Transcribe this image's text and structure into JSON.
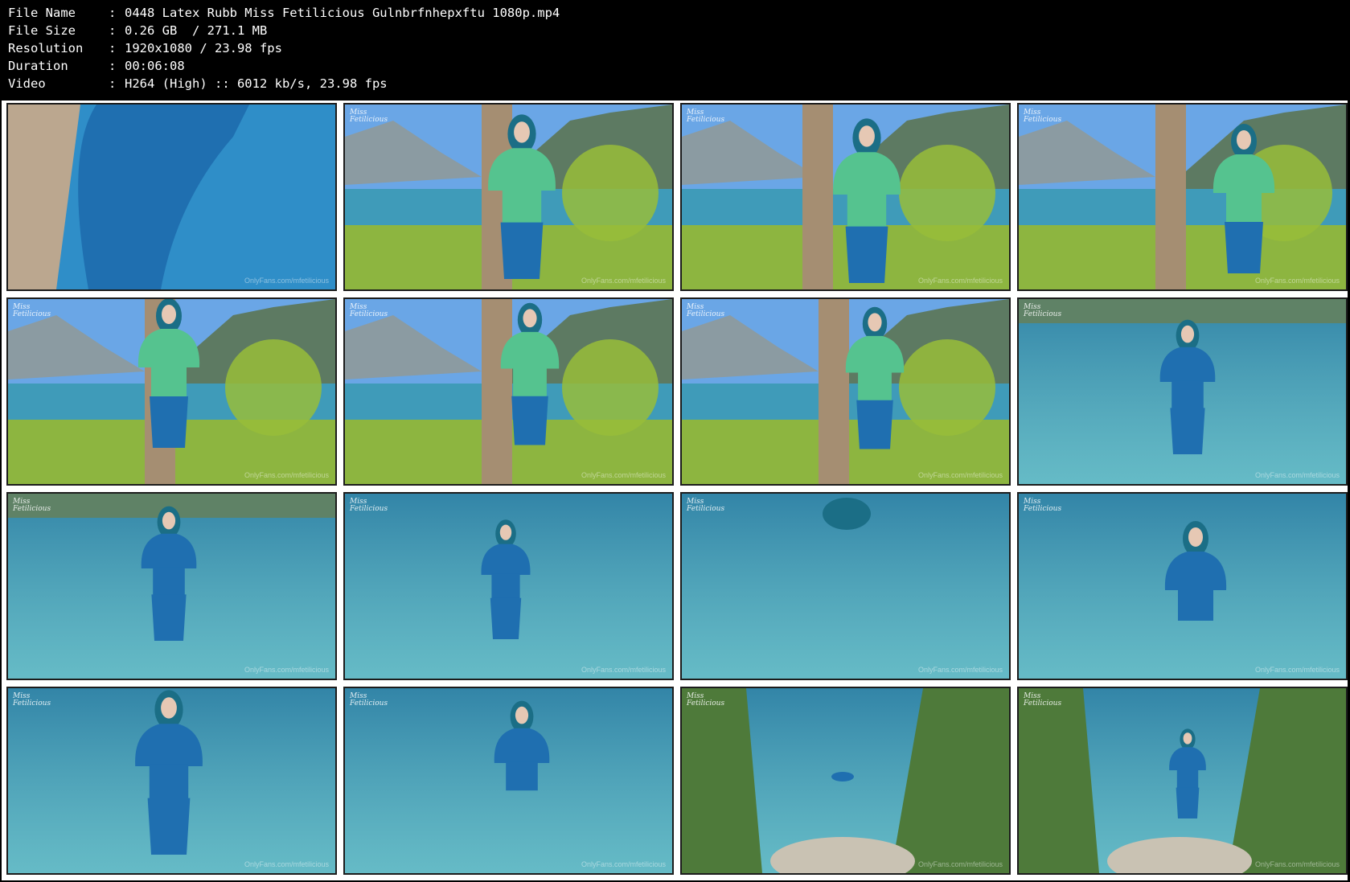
{
  "info": [
    {
      "key": "File Name",
      "value": "0448 Latex Rubb Miss Fetilicious Gulnbrfnhepxftu 1080p.mp4"
    },
    {
      "key": "File Size",
      "value": "0.26 GB  / 271.1 MB"
    },
    {
      "key": "Resolution",
      "value": "1920x1080 / 23.98 fps"
    },
    {
      "key": "Duration",
      "value": "00:06:08"
    },
    {
      "key": "Video",
      "value": "H264 (High) :: 6012 kb/s, 23.98 fps"
    }
  ],
  "separator": ":",
  "logo_text": "Miss Fetilicious",
  "watermark_text": "OnlyFans.com/mfetilicious",
  "thumbnails": [
    {
      "scene": "closeup-towel"
    },
    {
      "scene": "lake-green-top-glasses"
    },
    {
      "scene": "lake-green-top-glasses-2"
    },
    {
      "scene": "lake-green-top-side"
    },
    {
      "scene": "lake-green-top-hair"
    },
    {
      "scene": "lake-green-top-arms"
    },
    {
      "scene": "lake-green-top-pose"
    },
    {
      "scene": "water-standing"
    },
    {
      "scene": "water-standing-2"
    },
    {
      "scene": "water-wading"
    },
    {
      "scene": "water-swimming"
    },
    {
      "scene": "water-crouching"
    },
    {
      "scene": "water-closeup"
    },
    {
      "scene": "water-waist"
    },
    {
      "scene": "shore-far-swimming"
    },
    {
      "scene": "shore-far-standing"
    }
  ],
  "colors": {
    "background": "#000000",
    "sheet": "#ffffff",
    "sky": "#6aa6e6",
    "mountain": "#5d7a62",
    "lake": "#3f9bb9",
    "bush": "#8db540",
    "latex_blue": "#1f6fb0",
    "green_top": "#55c38f",
    "hair": "#1b6e86",
    "towel": "#2f8ec8",
    "stone": "#a58e72"
  }
}
